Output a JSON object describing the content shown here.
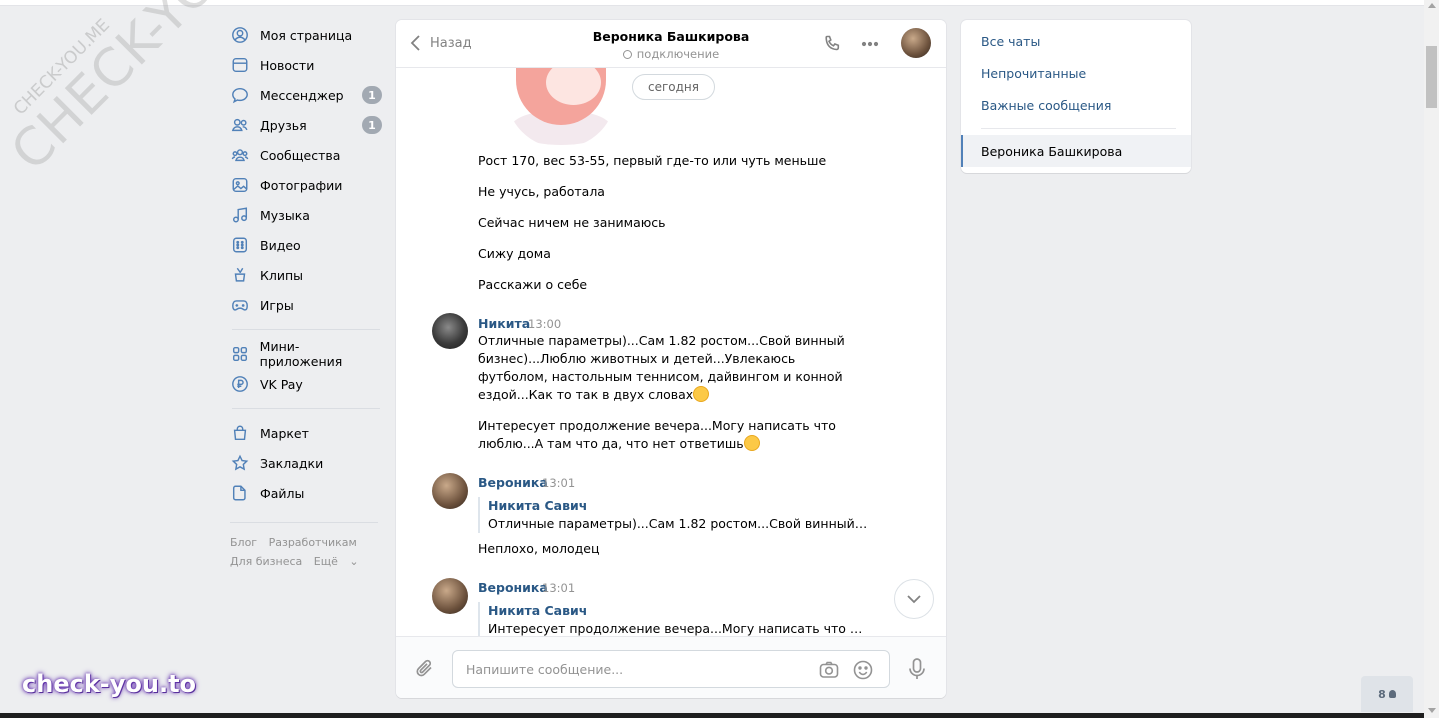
{
  "watermark": {
    "main": "CHECK-YOU.ME",
    "small": "CHECK-YOU.ME",
    "brand": "check-you.to"
  },
  "nav": {
    "items": [
      {
        "label": "Моя страница",
        "icon": "user-circle-icon"
      },
      {
        "label": "Новости",
        "icon": "news-icon"
      },
      {
        "label": "Мессенджер",
        "icon": "message-icon",
        "badge": "1"
      },
      {
        "label": "Друзья",
        "icon": "friends-icon",
        "badge": "1"
      },
      {
        "label": "Сообщества",
        "icon": "groups-icon"
      },
      {
        "label": "Фотографии",
        "icon": "photo-icon"
      },
      {
        "label": "Музыка",
        "icon": "music-icon"
      },
      {
        "label": "Видео",
        "icon": "video-icon"
      },
      {
        "label": "Клипы",
        "icon": "clips-icon"
      },
      {
        "label": "Игры",
        "icon": "gamepad-icon"
      }
    ],
    "group2": [
      {
        "label": "Мини-приложения",
        "icon": "apps-icon"
      },
      {
        "label": "VK Pay",
        "icon": "vkpay-icon"
      }
    ],
    "group3": [
      {
        "label": "Маркет",
        "icon": "bag-icon"
      },
      {
        "label": "Закладки",
        "icon": "star-icon"
      },
      {
        "label": "Файлы",
        "icon": "file-icon"
      }
    ],
    "footer": {
      "blog": "Блог",
      "devs": "Разработчикам",
      "business": "Для бизнеса",
      "more": "Ещё"
    }
  },
  "chat": {
    "back_label": "Назад",
    "peer_name": "Вероника Башкирова",
    "peer_status": "подключение",
    "date_pill": "сегодня",
    "plain_messages": [
      "Рост 170, вес 53-55, первый где-то или чуть меньше",
      "Не учусь, работала",
      "Сейчас ничем не занимаюсь",
      "Сижу дома",
      "Расскажи о себе"
    ],
    "msg1": {
      "author": "Никита",
      "time": "13:00",
      "text_a": "Отличные параметры)...Сам 1.82 ростом...Свой винный бизнес)...Люблю животных и детей...Увлекаюсь футболом, настольным теннисом, дайвингом и конной ездой...Как то так в двух словах",
      "text_b": "Интересует продолжение вечера...Могу написать что люблю...А там что да, что нет ответишь"
    },
    "msg2": {
      "author": "Вероника",
      "time": "13:01",
      "quote_author": "Никита Савич",
      "quote_text": "Отличные параметры)...Сам 1.82 ростом...Свой винный биз...",
      "text": "Неплохо, молодец"
    },
    "msg3": {
      "author": "Вероника",
      "time": "13:01",
      "quote_author": "Никита Савич",
      "quote_text": "Интересует продолжение вечера...Могу написать что любл..."
    },
    "composer_placeholder": "Напишите сообщение..."
  },
  "right": {
    "all_chats": "Все чаты",
    "unread": "Непрочитанные",
    "important": "Важные сообщения",
    "active_chat": "Вероника Башкирова"
  },
  "online_count": "8",
  "colors": {
    "accent": "#5181b8",
    "link": "#2a5885",
    "background": "#edeef0"
  }
}
